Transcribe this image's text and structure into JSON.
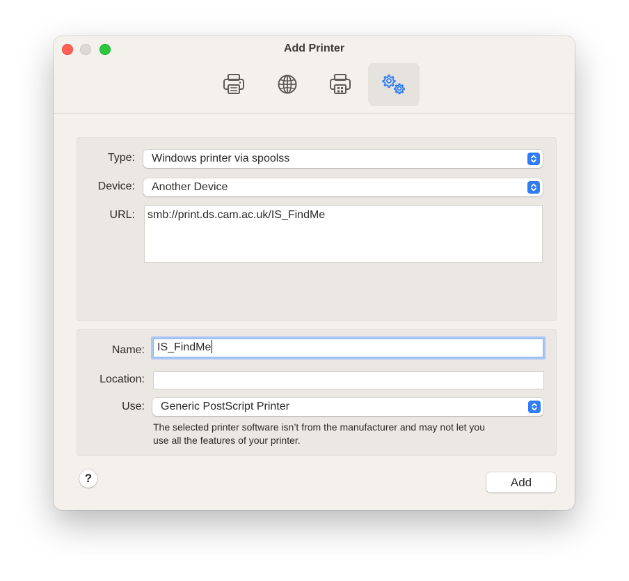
{
  "window": {
    "title": "Add Printer"
  },
  "toolbar": {
    "items": [
      {
        "icon": "printer-icon",
        "selected": false
      },
      {
        "icon": "globe-icon",
        "selected": false
      },
      {
        "icon": "network-printer-icon",
        "selected": false
      },
      {
        "icon": "gears-icon",
        "selected": true
      }
    ],
    "accent_color": "#2f7cf6"
  },
  "connection": {
    "type_label": "Type:",
    "type_value": "Windows printer via spoolss",
    "device_label": "Device:",
    "device_value": "Another Device",
    "url_label": "URL:",
    "url_value": "smb://print.ds.cam.ac.uk/IS_FindMe"
  },
  "details": {
    "name_label": "Name:",
    "name_value": "IS_FindMe",
    "location_label": "Location:",
    "location_value": "",
    "use_label": "Use:",
    "use_value": "Generic PostScript Printer",
    "note_line1": "The selected printer software isn’t from the manufacturer and may not let you",
    "note_line2": "use all the features of your printer."
  },
  "footer": {
    "help_label": "?",
    "add_label": "Add"
  }
}
